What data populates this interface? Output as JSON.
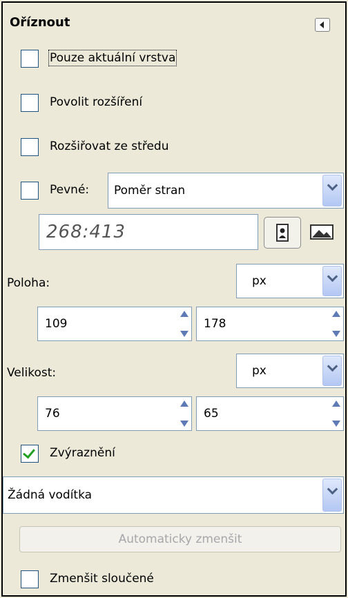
{
  "panel": {
    "title": "Oříznout"
  },
  "options": {
    "current_layer_label": "Pouze aktuální vrstva",
    "allow_growing_label": "Povolit rozšíření",
    "expand_center_label": "Rozšiřovat ze středu",
    "fixed_label": "Pevné:",
    "fixed_checked": false,
    "fixed_mode": "Poměr stran",
    "aspect_ratio": "268:413"
  },
  "position": {
    "label": "Poloha:",
    "unit": "px",
    "x": "109",
    "y": "178"
  },
  "size": {
    "label": "Velikost:",
    "unit": "px",
    "width": "76",
    "height": "65"
  },
  "highlight": {
    "label": "Zvýraznění",
    "checked": true
  },
  "guides": {
    "selected": "Žádná vodítka"
  },
  "auto_shrink": {
    "label": "Automaticky zmenšit"
  },
  "shrink_merged": {
    "label": "Zmenšit sloučené"
  }
}
